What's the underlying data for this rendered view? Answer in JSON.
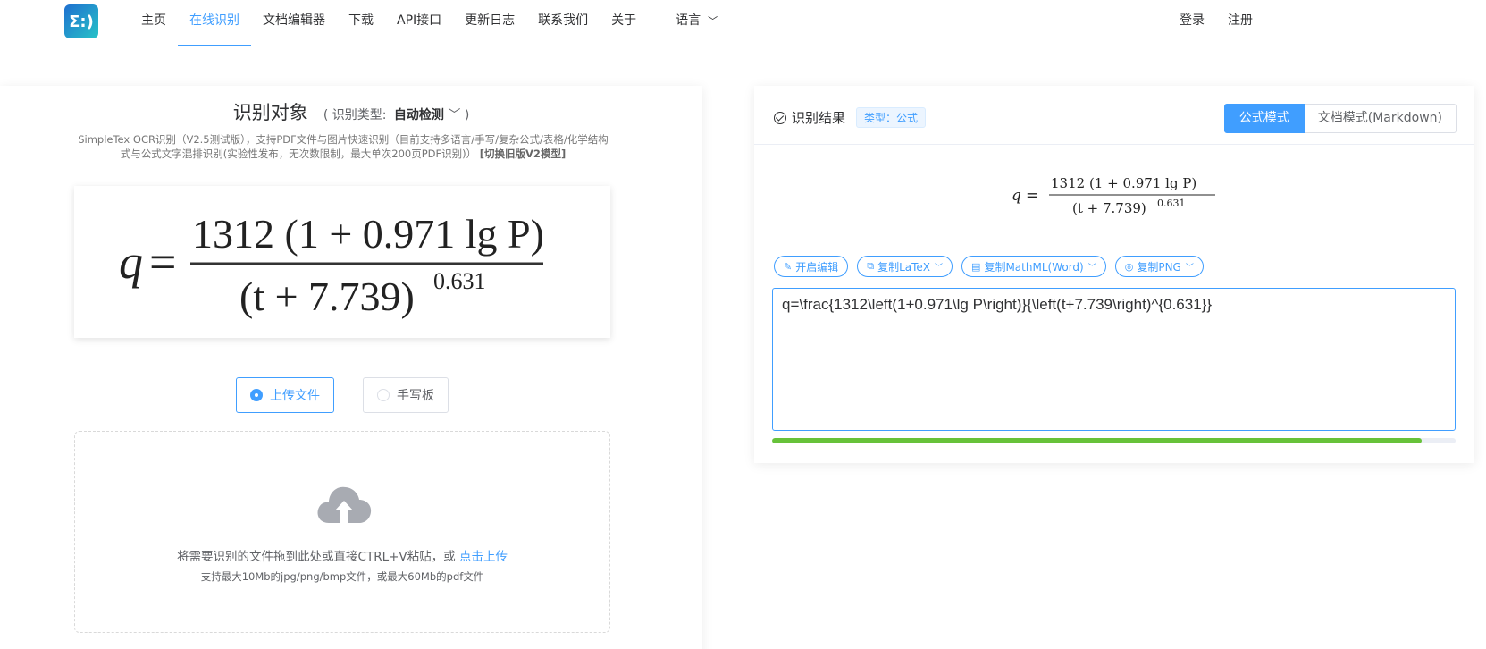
{
  "nav": {
    "logo_text": "Σ:)",
    "items": [
      "主页",
      "在线识别",
      "文档编辑器",
      "下载",
      "API接口",
      "更新日志",
      "联系我们",
      "关于",
      "语言"
    ],
    "active_index": 1,
    "login": "登录",
    "register": "注册"
  },
  "left": {
    "title": "识别对象",
    "type_label": "( 识别类型:",
    "type_value": "自动检测",
    "type_close": ")",
    "desc": "SimpleTex OCR识别（V2.5测试版），支持PDF文件与图片快速识别（目前支持多语言/手写/复杂公式/表格/化学结构式与公式文字混排识别(实验性发布，无次数限制，最大单次200页PDF识别)）",
    "switch_link": "[切换旧版V2模型]",
    "modes": [
      "上传文件",
      "手写板"
    ],
    "drop_text": "将需要识别的文件拖到此处或直接CTRL+V粘贴，或",
    "drop_link": "点击上传",
    "drop_hint": "支持最大10Mb的jpg/png/bmp文件，或最大60Mb的pdf文件"
  },
  "right": {
    "title": "识别结果",
    "tag": "类型：公式",
    "mode_formula": "公式模式",
    "mode_doc": "文档模式(Markdown)",
    "tools": [
      "开启编辑",
      "复制LaTeX",
      "复制MathML(Word)",
      "复制PNG"
    ],
    "latex": "q=\\frac{1312\\left(1+0.971\\lg P\\right)}{\\left(t+7.739\\right)^{0.631}}",
    "progress": 0.95
  },
  "formula": {
    "lhs": "q",
    "numerator": "1312 (1 + 0.971 lg P)",
    "denominator_base": "(t + 7.739)",
    "exponent": "0.631"
  },
  "colors": {
    "primary": "#409eff",
    "progress": "#67c23a"
  }
}
